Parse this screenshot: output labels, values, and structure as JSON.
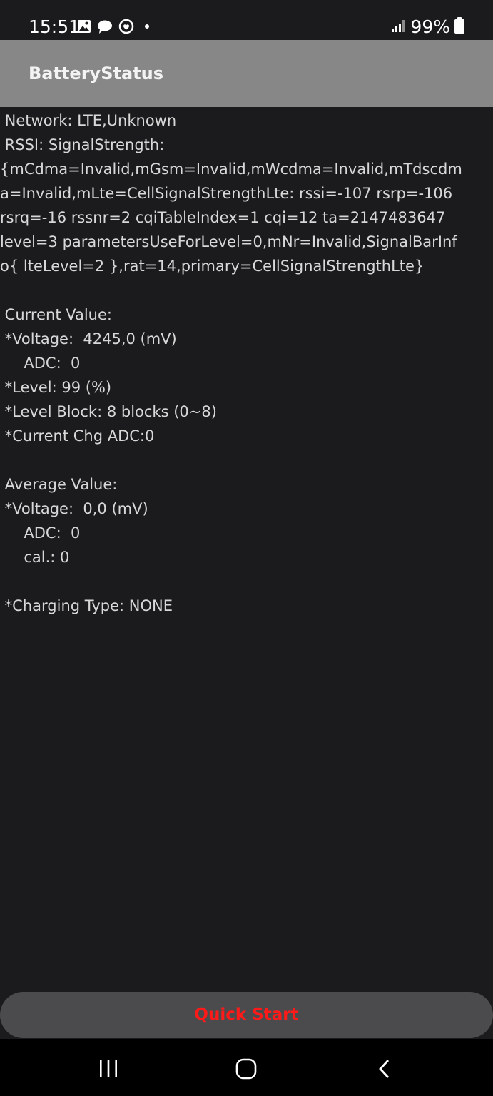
{
  "status_bar": {
    "time": "15:51",
    "battery_percent": "99%",
    "notification_icons": [
      "gallery-icon",
      "chat-icon",
      "messenger-icon",
      "dot-icon"
    ],
    "signal_icon": "signal-icon",
    "battery_icon": "battery-icon"
  },
  "app_bar": {
    "title": "BatteryStatus"
  },
  "content": {
    "lines": [
      " Network: LTE,Unknown",
      " RSSI: SignalStrength:",
      "{mCdma=Invalid,mGsm=Invalid,mWcdma=Invalid,mTdscdm",
      "a=Invalid,mLte=CellSignalStrengthLte: rssi=-107 rsrp=-106",
      "rsrq=-16 rssnr=2 cqiTableIndex=1 cqi=12 ta=2147483647",
      "level=3 parametersUseForLevel=0,mNr=Invalid,SignalBarInf",
      "o{ lteLevel=2 },rat=14,primary=CellSignalStrengthLte}",
      "",
      " Current Value:",
      " *Voltage:  4245,0 (mV)",
      "     ADC:  0",
      " *Level: 99 (%)",
      " *Level Block: 8 blocks (0~8)",
      " *Current Chg ADC:0",
      "",
      " Average Value:",
      " *Voltage:  0,0 (mV)",
      "     ADC:  0",
      "     cal.: 0",
      "",
      " *Charging Type: NONE"
    ]
  },
  "quick_start": {
    "label": "Quick Start",
    "color": "#ff1a1a"
  },
  "nav_bar": {
    "buttons": [
      "recents-icon",
      "home-icon",
      "back-icon"
    ]
  },
  "colors": {
    "background": "#1b1b1d",
    "app_bar": "#878787",
    "text": "#d8d8d8",
    "button": "#4b4b4d"
  }
}
